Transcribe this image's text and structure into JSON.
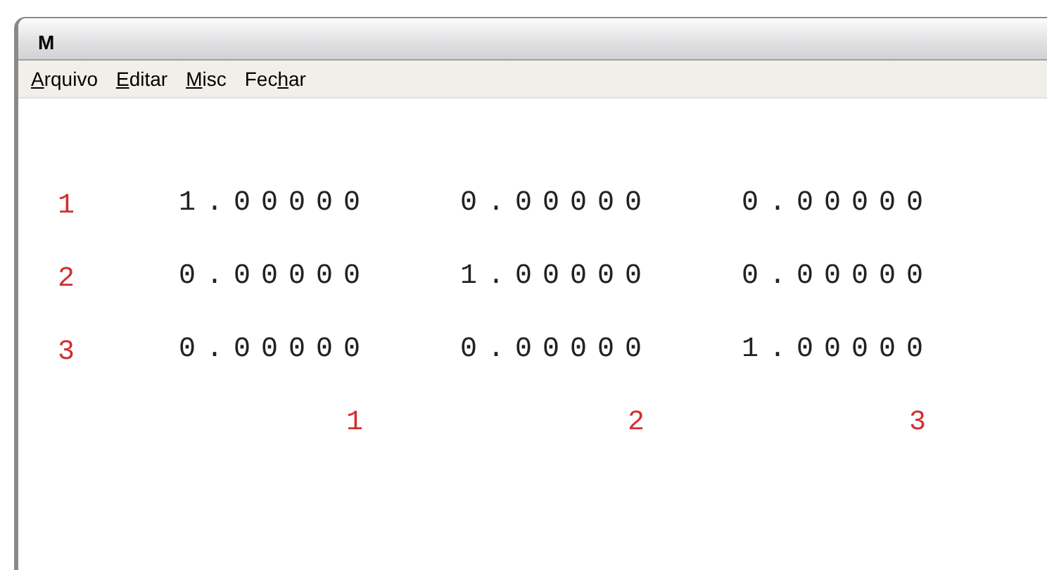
{
  "window": {
    "title": "M"
  },
  "menu": [
    {
      "key": "A",
      "after": "rquivo"
    },
    {
      "key": "E",
      "after": "ditar"
    },
    {
      "key": "M",
      "after": "isc"
    },
    {
      "before": "Fec",
      "key": "h",
      "after": "ar"
    }
  ],
  "matrix": {
    "rows": [
      {
        "label": "1",
        "cells": [
          "1.00000",
          "0.00000",
          "0.00000"
        ]
      },
      {
        "label": "2",
        "cells": [
          "0.00000",
          "1.00000",
          "0.00000"
        ]
      },
      {
        "label": "3",
        "cells": [
          "0.00000",
          "0.00000",
          "1.00000"
        ]
      }
    ],
    "column_labels": [
      "1",
      "2",
      "3"
    ]
  }
}
